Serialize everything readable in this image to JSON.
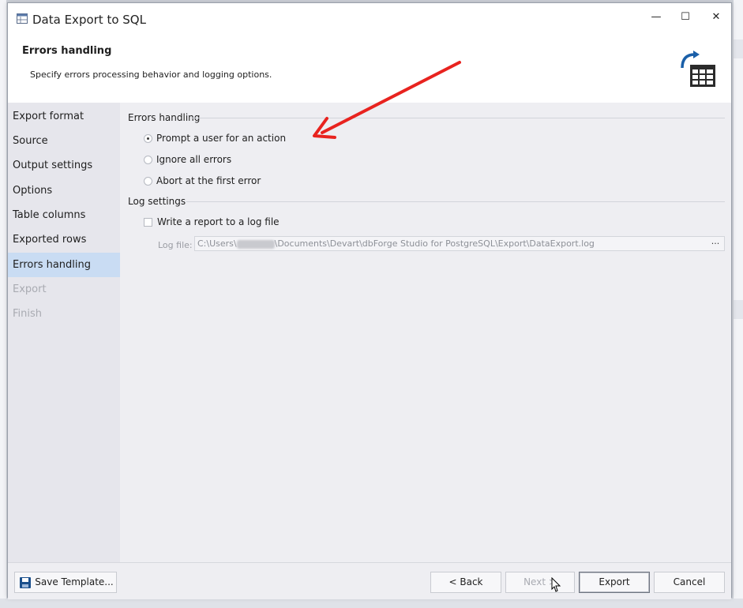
{
  "window": {
    "title": "Data Export to SQL",
    "minimize_icon": "minimize-icon",
    "maximize_icon": "maximize-icon",
    "close_icon": "close-icon",
    "minimize_glyph": "—",
    "maximize_glyph": "☐",
    "close_glyph": "✕"
  },
  "header": {
    "title": "Errors handling",
    "description": "Specify errors processing behavior and logging options.",
    "icon": "export-table-icon"
  },
  "sidebar": {
    "items": [
      {
        "label": "Export format",
        "state": "normal"
      },
      {
        "label": "Source",
        "state": "normal"
      },
      {
        "label": "Output settings",
        "state": "normal"
      },
      {
        "label": "Options",
        "state": "normal"
      },
      {
        "label": "Table columns",
        "state": "normal"
      },
      {
        "label": "Exported rows",
        "state": "normal"
      },
      {
        "label": "Errors handling",
        "state": "active"
      },
      {
        "label": "Export",
        "state": "disabled"
      },
      {
        "label": "Finish",
        "state": "disabled"
      }
    ]
  },
  "errors_handling": {
    "section_label": "Errors handling",
    "options": [
      {
        "label": "Prompt a user for an action",
        "selected": true
      },
      {
        "label": "Ignore all errors",
        "selected": false
      },
      {
        "label": "Abort at the first error",
        "selected": false
      }
    ]
  },
  "log_settings": {
    "section_label": "Log settings",
    "write_report_label": "Write a report to a log file",
    "write_report_checked": false,
    "log_file_label": "Log file:",
    "log_file_prefix": "C:\\Users\\",
    "log_file_suffix": "\\Documents\\Devart\\dbForge Studio for PostgreSQL\\Export\\DataExport.log",
    "browse_label": "···"
  },
  "footer": {
    "save_template_label": "Save Template...",
    "back_label": "< Back",
    "next_label": "Next >",
    "export_label": "Export",
    "cancel_label": "Cancel"
  },
  "annotation": {
    "arrow_color": "#e8231f"
  },
  "colors": {
    "active_nav": "#c9dcf3",
    "accent_blue": "#1a5fa8"
  }
}
